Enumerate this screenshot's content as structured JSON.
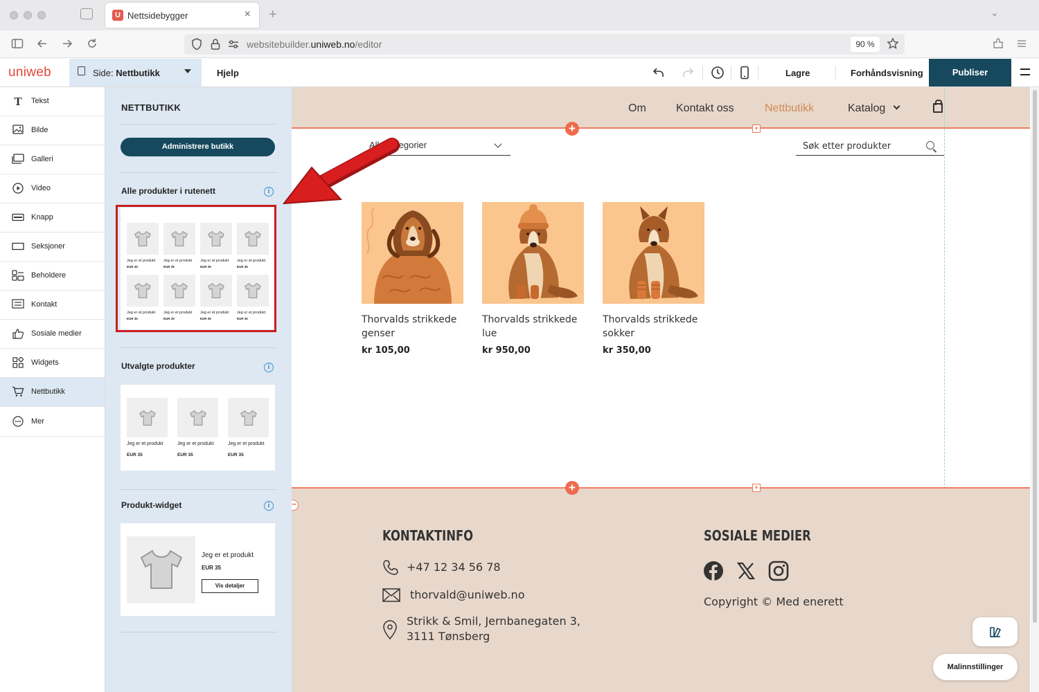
{
  "browser": {
    "tab_title": "Nettsidebygger",
    "tab_favicon": "U",
    "tab_close": "×",
    "new_tab": "+",
    "url_host_prefix": "websitebuilder.",
    "url_domain": "uniweb.no",
    "url_path": "/editor",
    "zoom": "90 %"
  },
  "editor": {
    "logo": "uniweb",
    "page_select": {
      "prefix": "Side: ",
      "value": "Nettbutikk"
    },
    "help": "Hjelp",
    "save": "Lagre",
    "preview": "Forhåndsvisning",
    "publish": "Publiser"
  },
  "tools": [
    {
      "label": "Tekst",
      "icon": "text-icon"
    },
    {
      "label": "Bilde",
      "icon": "image-icon"
    },
    {
      "label": "Galleri",
      "icon": "gallery-icon"
    },
    {
      "label": "Video",
      "icon": "video-icon"
    },
    {
      "label": "Knapp",
      "icon": "button-icon"
    },
    {
      "label": "Seksjoner",
      "icon": "sections-icon"
    },
    {
      "label": "Beholdere",
      "icon": "containers-icon"
    },
    {
      "label": "Kontakt",
      "icon": "contact-form-icon"
    },
    {
      "label": "Sosiale medier",
      "icon": "thumbs-up-icon"
    },
    {
      "label": "Widgets",
      "icon": "widgets-icon"
    },
    {
      "label": "Nettbutikk",
      "icon": "cart-icon",
      "active": true
    },
    {
      "label": "Mer",
      "icon": "more-icon"
    }
  ],
  "shop_panel": {
    "title": "NETTBUTIKK",
    "manage_button": "Administrere butikk",
    "grid_section": {
      "title": "Alle produkter i rutenett",
      "product_name": "Jeg er et produkt",
      "product_price": "EUR 35"
    },
    "featured_section": {
      "title": "Utvalgte produkter",
      "product_name": "Jeg er et produkt",
      "product_price": "EUR 35"
    },
    "widget_section": {
      "title": "Produkt-widget",
      "product_name": "Jeg er et produkt",
      "product_price": "EUR 35",
      "details_button": "Vis detaljer"
    }
  },
  "site": {
    "nav": [
      "Om",
      "Kontakt oss",
      "Nettbutikk",
      "Katalog"
    ],
    "nav_active_color": "#d08a55",
    "category_select": "Alle kategorier",
    "search_placeholder": "Søk etter produkter",
    "products": [
      {
        "name": "Thorvalds strikkede genser",
        "price": "kr 105,00",
        "image": "dog-sweater-illustration"
      },
      {
        "name": "Thorvalds strikkede lue",
        "price": "kr 950,00",
        "image": "dog-hat-illustration"
      },
      {
        "name": "Thorvalds strikkede sokker",
        "price": "kr 350,00",
        "image": "dog-socks-illustration"
      }
    ],
    "footer": {
      "contact_heading": "KONTAKTINFO",
      "phone": "+47 12 34 56 78",
      "email": "thorvald@uniweb.no",
      "address_line1": "Strikk & Smil, Jernbanegaten 3,",
      "address_line2": "3111 Tønsberg",
      "social_heading": "SOSIALE MEDIER",
      "social_icons": [
        "facebook-icon",
        "x-icon",
        "instagram-icon"
      ],
      "copyright": "Copyright © Med enerett"
    }
  },
  "template_settings": "Malinnstillinger",
  "colors": {
    "publish": "#16495d",
    "accent": "#ee7b5f",
    "site_bg": "#e8d8cb",
    "panel_bg": "#dde8f2",
    "highlight": "#cc1b1b"
  }
}
